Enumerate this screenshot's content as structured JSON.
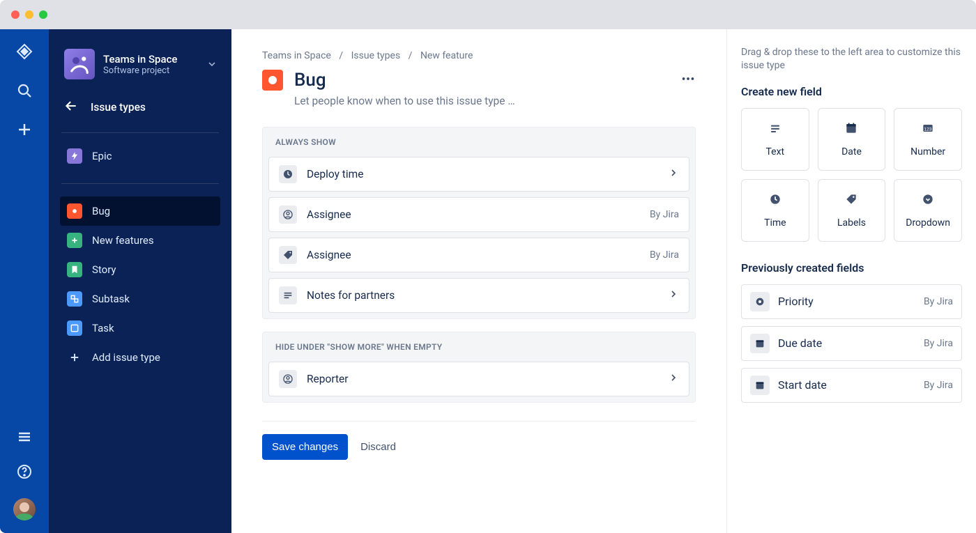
{
  "project": {
    "name": "Teams in Space",
    "subtitle": "Software project"
  },
  "sidebar": {
    "back_label": "Issue types",
    "items": [
      {
        "label": "Epic"
      },
      {
        "label": "Bug"
      },
      {
        "label": "New features"
      },
      {
        "label": "Story"
      },
      {
        "label": "Subtask"
      },
      {
        "label": "Task"
      }
    ],
    "add_label": "Add issue type"
  },
  "breadcrumb": {
    "a": "Teams in Space",
    "b": "Issue types",
    "c": "New feature"
  },
  "page": {
    "title": "Bug",
    "subtitle": "Let people know when to use this issue type …"
  },
  "sections": {
    "always": {
      "header": "ALWAYS SHOW",
      "fields": [
        {
          "label": "Deploy time",
          "meta": ""
        },
        {
          "label": "Assignee",
          "meta": "By Jira"
        },
        {
          "label": "Assignee",
          "meta": "By Jira"
        },
        {
          "label": "Notes for partners",
          "meta": ""
        }
      ]
    },
    "hide": {
      "header": "HIDE UNDER \"SHOW MORE\" WHEN EMPTY",
      "fields": [
        {
          "label": "Reporter",
          "meta": ""
        }
      ]
    }
  },
  "actions": {
    "save": "Save changes",
    "discard": "Discard"
  },
  "right": {
    "hint": "Drag & drop these to the left area to customize this issue type",
    "create_heading": "Create new field",
    "field_types": [
      {
        "label": "Text"
      },
      {
        "label": "Date"
      },
      {
        "label": "Number"
      },
      {
        "label": "Time"
      },
      {
        "label": "Labels"
      },
      {
        "label": "Dropdown"
      }
    ],
    "prev_heading": "Previously created fields",
    "prev_fields": [
      {
        "label": "Priority",
        "meta": "By Jira"
      },
      {
        "label": "Due date",
        "meta": "By Jira"
      },
      {
        "label": "Start date",
        "meta": "By Jira"
      }
    ]
  }
}
